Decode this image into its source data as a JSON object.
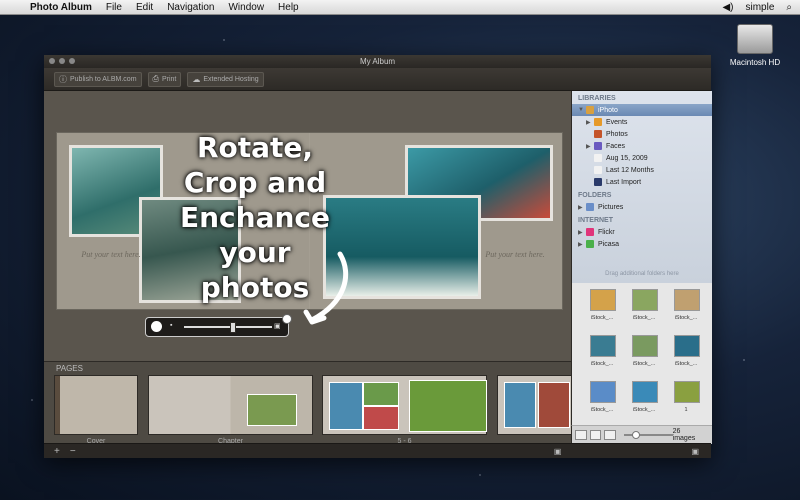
{
  "menubar": {
    "apple": "",
    "app_name": "Photo Album",
    "items": [
      "File",
      "Edit",
      "Navigation",
      "Window",
      "Help"
    ],
    "user": "simple"
  },
  "desktop": {
    "hd_label": "Macintosh HD"
  },
  "window": {
    "title": "My Album"
  },
  "toolbar": {
    "publish": "Publish to ALBM.com",
    "print": "Print",
    "hosting": "Extended Hosting"
  },
  "spread": {
    "left_text": "Put your text here.",
    "right_text": "Put your text here."
  },
  "overlay": {
    "lines": [
      "Rotate,",
      "Crop and",
      "Enchance",
      "your photos"
    ]
  },
  "pages": {
    "label": "PAGES",
    "items": [
      {
        "caption": "Cover"
      },
      {
        "caption": "Chapter"
      },
      {
        "caption": "5 - 6"
      }
    ]
  },
  "sidebar": {
    "libraries_header": "LIBRARIES",
    "libraries": [
      {
        "label": "iPhoto",
        "selected": true,
        "expand": "▼"
      },
      {
        "label": "Events",
        "indent": true,
        "expand": "▶",
        "color": "#e69a2a"
      },
      {
        "label": "Photos",
        "indent": true,
        "expand": "",
        "color": "#c4542a"
      },
      {
        "label": "Faces",
        "indent": true,
        "expand": "▶",
        "color": "#6a5ac0"
      },
      {
        "label": "Aug 15, 2009",
        "indent": true,
        "expand": "",
        "color": "#f2f2f2"
      },
      {
        "label": "Last 12 Months",
        "indent": true,
        "expand": "",
        "color": "#f2f2f2"
      },
      {
        "label": "Last Import",
        "indent": true,
        "expand": "",
        "color": "#2a3a6a"
      }
    ],
    "folders_header": "FOLDERS",
    "folders": [
      {
        "label": "Pictures",
        "expand": "▶",
        "color": "#6a8ec8"
      }
    ],
    "internet_header": "INTERNET",
    "internet": [
      {
        "label": "Flickr",
        "expand": "▶",
        "color": "#e0347a"
      },
      {
        "label": "Picasa",
        "expand": "▶",
        "color": "#4ab04a"
      }
    ],
    "hint": "Drag additional folders here"
  },
  "media": {
    "thumbs": [
      {
        "caption": "iStock_...",
        "color": "#d4a24a"
      },
      {
        "caption": "iStock_...",
        "color": "#8aa660"
      },
      {
        "caption": "iStock_...",
        "color": "#c0a070"
      },
      {
        "caption": "iStock_...",
        "color": "#3a7c92"
      },
      {
        "caption": "iStock_...",
        "color": "#7a9a60"
      },
      {
        "caption": "iStock_...",
        "color": "#2a6e8a"
      },
      {
        "caption": "iStock_...",
        "color": "#5a8cc8"
      },
      {
        "caption": "iStock_...",
        "color": "#3a8ab8"
      },
      {
        "caption": "1",
        "color": "#8aa040"
      }
    ],
    "count": "26 images"
  }
}
